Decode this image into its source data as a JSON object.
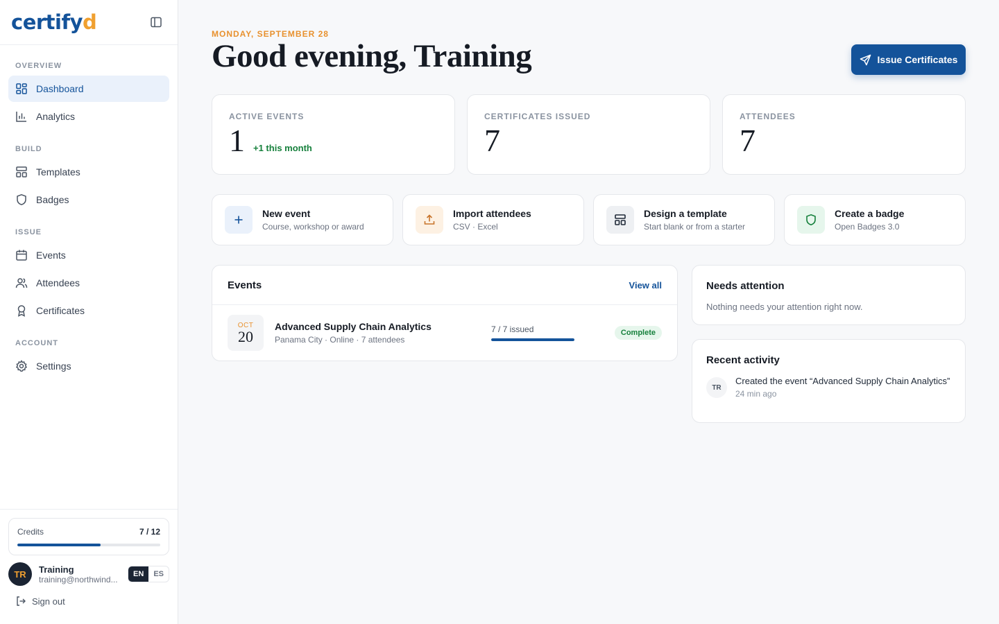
{
  "brand": {
    "logo_main": "certify",
    "logo_accent": "d"
  },
  "colors": {
    "primary": "#14539a",
    "accent": "#f0a030",
    "success": "#16803c",
    "date_orange": "#e8912e"
  },
  "sidebar": {
    "sections": [
      {
        "label": "OVERVIEW",
        "items": [
          {
            "label": "Dashboard",
            "icon": "dashboard-icon",
            "active": true
          },
          {
            "label": "Analytics",
            "icon": "analytics-icon"
          }
        ]
      },
      {
        "label": "BUILD",
        "items": [
          {
            "label": "Templates",
            "icon": "templates-icon"
          },
          {
            "label": "Badges",
            "icon": "shield-icon"
          }
        ]
      },
      {
        "label": "ISSUE",
        "items": [
          {
            "label": "Events",
            "icon": "calendar-icon"
          },
          {
            "label": "Attendees",
            "icon": "users-icon"
          },
          {
            "label": "Certificates",
            "icon": "award-icon"
          }
        ]
      },
      {
        "label": "ACCOUNT",
        "items": [
          {
            "label": "Settings",
            "icon": "gear-icon"
          }
        ]
      }
    ],
    "credits": {
      "label": "Credits",
      "count": "7 / 12",
      "used": 7,
      "total": 12
    },
    "user": {
      "initials": "TR",
      "name": "Training",
      "email": "training@northwind..."
    },
    "languages": [
      {
        "code": "EN",
        "active": true
      },
      {
        "code": "ES",
        "active": false
      }
    ],
    "signout_label": "Sign out"
  },
  "header": {
    "date": "MONDAY, SEPTEMBER 28",
    "greeting": "Good evening, Training",
    "issue_button": "Issue Certificates"
  },
  "stats": [
    {
      "label": "ACTIVE EVENTS",
      "value": "1",
      "delta": "+1 this month"
    },
    {
      "label": "CERTIFICATES ISSUED",
      "value": "7",
      "delta": ""
    },
    {
      "label": "ATTENDEES",
      "value": "7",
      "delta": ""
    }
  ],
  "actions": [
    {
      "title": "New event",
      "subtitle": "Course, workshop or award",
      "icon": "plus-icon"
    },
    {
      "title": "Import attendees",
      "subtitle": "CSV · Excel",
      "icon": "upload-icon"
    },
    {
      "title": "Design a template",
      "subtitle": "Start blank or from a starter",
      "icon": "template-icon"
    },
    {
      "title": "Create a badge",
      "subtitle": "Open Badges 3.0",
      "icon": "shield-icon"
    }
  ],
  "events": {
    "title": "Events",
    "view_all": "View all",
    "items": [
      {
        "month": "OCT",
        "day": "20",
        "name": "Advanced Supply Chain Analytics",
        "meta": "Panama City · Online · 7 attendees",
        "issued_label": "7 / 7 issued",
        "issued": 7,
        "total": 7,
        "status": "Complete"
      }
    ]
  },
  "attention": {
    "title": "Needs attention",
    "text": "Nothing needs your attention right now."
  },
  "activity": {
    "title": "Recent activity",
    "items": [
      {
        "initials": "TR",
        "text": "Created the event “Advanced Supply Chain Analytics”",
        "time": "24 min ago"
      }
    ]
  }
}
